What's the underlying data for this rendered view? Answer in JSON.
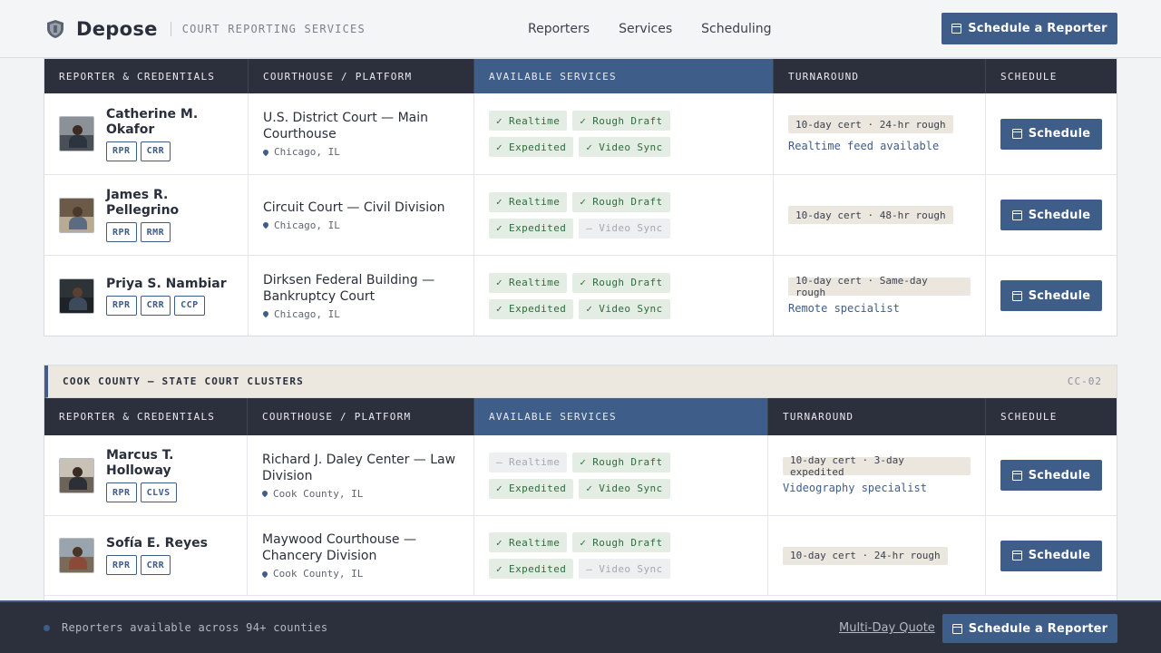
{
  "header": {
    "brand": "Depose",
    "tagline": "COURT REPORTING SERVICES",
    "nav": [
      "Reporters",
      "Services",
      "Scheduling"
    ],
    "cta": "Schedule a Reporter"
  },
  "columns": [
    "REPORTER & CREDENTIALS",
    "COURTHOUSE / PLATFORM",
    "AVAILABLE SERVICES",
    "TURNAROUND",
    "SCHEDULE"
  ],
  "table1": {
    "rows": [
      {
        "name_l1": "Catherine M.",
        "name_l2": "Okafor",
        "creds": [
          "RPR",
          "CRR"
        ],
        "court_l1": "U.S. District Court — Main",
        "court_l2": "Courthouse",
        "location": "Chicago, IL",
        "services": [
          "✓ Realtime",
          "✓ Rough Draft",
          "✓ Expedited",
          "✓ Video Sync"
        ],
        "turnaround": "10-day cert · 24-hr rough",
        "note": "Realtime feed available",
        "button": "Schedule"
      },
      {
        "name_l1": "James R.",
        "name_l2": "Pellegrino",
        "creds": [
          "RPR",
          "RMR"
        ],
        "court_l1": "Circuit Court — Civil Division",
        "court_l2": "",
        "location": "Chicago, IL",
        "services": [
          "✓ Realtime",
          "✓ Rough Draft",
          "✓ Expedited",
          "– Video Sync"
        ],
        "turnaround": "10-day cert · 48-hr rough",
        "note": "",
        "button": "Schedule"
      },
      {
        "name_l1": "Priya S. Nambiar",
        "name_l2": "",
        "creds": [
          "RPR",
          "CRR",
          "CCP"
        ],
        "court_l1": "Dirksen Federal Building —",
        "court_l2": "Bankruptcy Court",
        "location": "Chicago, IL",
        "services": [
          "✓ Realtime",
          "✓ Rough Draft",
          "✓ Expedited",
          "✓ Video Sync"
        ],
        "turnaround": "10-day cert · Same-day rough",
        "note": "Remote specialist",
        "button": "Schedule"
      }
    ]
  },
  "section2": {
    "title": "COOK COUNTY — STATE COURT CLUSTERS",
    "code": "CC-02"
  },
  "table2": {
    "rows": [
      {
        "name_l1": "Marcus T.",
        "name_l2": "Holloway",
        "creds": [
          "RPR",
          "CLVS"
        ],
        "court_l1": "Richard J. Daley Center — Law",
        "court_l2": "Division",
        "location": "Cook County, IL",
        "services": [
          "– Realtime",
          "✓ Rough Draft",
          "✓ Expedited",
          "✓ Video Sync"
        ],
        "turnaround": "10-day cert · 3-day expedited",
        "note": "Videography specialist",
        "button": "Schedule"
      },
      {
        "name_l1": "Sofía E. Reyes",
        "name_l2": "",
        "creds": [
          "RPR",
          "CRR"
        ],
        "court_l1": "Maywood Courthouse —",
        "court_l2": "Chancery Division",
        "location": "Cook County, IL",
        "services": [
          "✓ Realtime",
          "✓ Rough Draft",
          "✓ Expedited",
          "– Video Sync"
        ],
        "turnaround": "10-day cert · 24-hr rough",
        "note": "",
        "button": "Schedule"
      }
    ]
  },
  "footer": {
    "status": "Reporters available across 94+ counties",
    "link": "Multi-Day Quote",
    "cta": "Schedule a Reporter"
  },
  "colors": {
    "accent": "#3f5d89",
    "dark": "#2c303d",
    "service_on": "#2f6b3c"
  }
}
